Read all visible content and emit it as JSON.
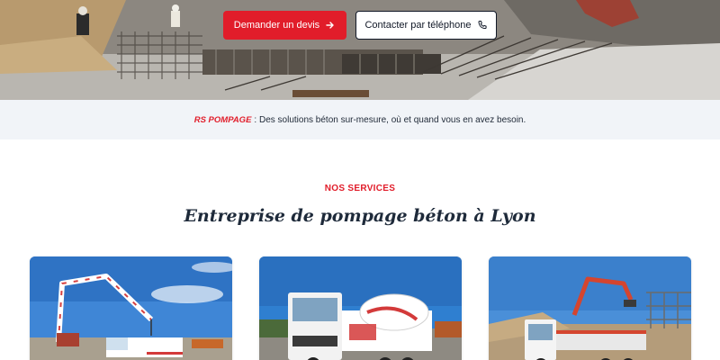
{
  "hero": {
    "primary_button": "Demander un devis",
    "secondary_button": "Contacter par téléphone",
    "icons": {
      "primary": "arrow-right-icon",
      "secondary": "phone-icon"
    },
    "colors": {
      "accent": "#e11d2a",
      "dark": "#111827"
    }
  },
  "tagline": {
    "brand": "RS POMPAGE",
    "text": ": Des solutions béton sur-mesure, où et quand vous en avez besoin."
  },
  "services": {
    "eyebrow": "NOS SERVICES",
    "title": "Entreprise de pompage béton à Lyon"
  }
}
